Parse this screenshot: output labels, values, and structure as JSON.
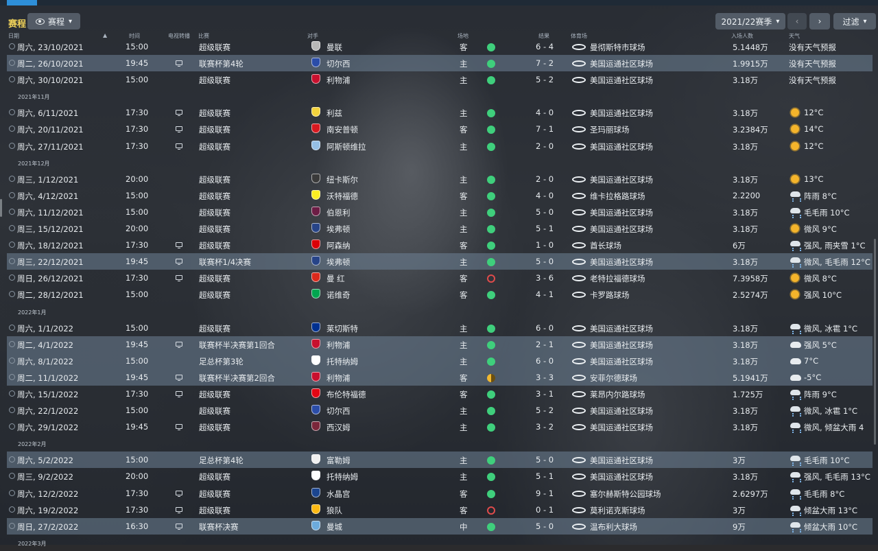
{
  "header": {
    "title": "赛程",
    "view_button": "赛程",
    "season_button": "2021/22赛季",
    "filter_button": "过滤"
  },
  "columns": {
    "date": "日期",
    "time": "时间",
    "tv": "电视转播",
    "competition": "比赛",
    "opponent": "对手",
    "venue": "场地",
    "result": "结果",
    "stadium": "体育场",
    "attendance": "入场人数",
    "weather": "天气"
  },
  "rows": [
    {
      "type": "match",
      "date": "周六, 23/10/2021",
      "time": "15:00",
      "tv": false,
      "comp": "超级联赛",
      "opp": "曼联",
      "venue": "客",
      "res": "win",
      "score": "6 - 4",
      "stadium": "曼彻斯特市球场",
      "att": "5.1448万",
      "wx": "none",
      "weather": "没有天气预报",
      "crest": "#b8b8b8",
      "hl": false
    },
    {
      "type": "match",
      "date": "周二, 26/10/2021",
      "time": "19:45",
      "tv": true,
      "comp": "联赛杯第4轮",
      "opp": "切尔西",
      "venue": "主",
      "res": "win",
      "score": "7 - 2",
      "stadium": "美国运通社区球场",
      "att": "1.9915万",
      "wx": "none",
      "weather": "没有天气预报",
      "crest": "#2b4da8",
      "hl": true
    },
    {
      "type": "match",
      "date": "周六, 30/10/2021",
      "time": "15:00",
      "tv": false,
      "comp": "超级联赛",
      "opp": "利物浦",
      "venue": "主",
      "res": "win",
      "score": "5 - 2",
      "stadium": "美国运通社区球场",
      "att": "3.18万",
      "wx": "none",
      "weather": "没有天气预报",
      "crest": "#c8102e",
      "hl": false
    },
    {
      "type": "month",
      "label": "2021年11月"
    },
    {
      "type": "match",
      "date": "周六, 6/11/2021",
      "time": "17:30",
      "tv": true,
      "comp": "超级联赛",
      "opp": "利兹",
      "venue": "主",
      "res": "win",
      "score": "4 - 0",
      "stadium": "美国运通社区球场",
      "att": "3.18万",
      "wx": "sun",
      "weather": "12°C",
      "crest": "#f2d23c",
      "hl": false
    },
    {
      "type": "match",
      "date": "周六, 20/11/2021",
      "time": "17:30",
      "tv": true,
      "comp": "超级联赛",
      "opp": "南安普顿",
      "venue": "客",
      "res": "win",
      "score": "7 - 1",
      "stadium": "圣玛丽球场",
      "att": "3.2384万",
      "wx": "sun",
      "weather": "14°C",
      "crest": "#d71920",
      "hl": false
    },
    {
      "type": "match",
      "date": "周六, 27/11/2021",
      "time": "17:30",
      "tv": true,
      "comp": "超级联赛",
      "opp": "阿斯顿维拉",
      "venue": "主",
      "res": "win",
      "score": "2 - 0",
      "stadium": "美国运通社区球场",
      "att": "3.18万",
      "wx": "sun",
      "weather": "12°C",
      "crest": "#95bfe5",
      "hl": false
    },
    {
      "type": "month",
      "label": "2021年12月"
    },
    {
      "type": "match",
      "date": "周三, 1/12/2021",
      "time": "20:00",
      "tv": false,
      "comp": "超级联赛",
      "opp": "纽卡斯尔",
      "venue": "主",
      "res": "win",
      "score": "2 - 0",
      "stadium": "美国运通社区球场",
      "att": "3.18万",
      "wx": "sun",
      "weather": "13°C",
      "crest": "#3a3a3a",
      "hl": false
    },
    {
      "type": "match",
      "date": "周六, 4/12/2021",
      "time": "15:00",
      "tv": false,
      "comp": "超级联赛",
      "opp": "沃特福德",
      "venue": "客",
      "res": "win",
      "score": "4 - 0",
      "stadium": "维卡拉格路球场",
      "att": "2.2200",
      "wx": "rain",
      "weather": "阵雨 8°C",
      "crest": "#fbee23",
      "hl": false
    },
    {
      "type": "match",
      "date": "周六, 11/12/2021",
      "time": "15:00",
      "tv": false,
      "comp": "超级联赛",
      "opp": "伯恩利",
      "venue": "主",
      "res": "win",
      "score": "5 - 0",
      "stadium": "美国运通社区球场",
      "att": "3.18万",
      "wx": "rain",
      "weather": "毛毛雨 10°C",
      "crest": "#6c1d45",
      "hl": false
    },
    {
      "type": "match",
      "date": "周三, 15/12/2021",
      "time": "20:00",
      "tv": false,
      "comp": "超级联赛",
      "opp": "埃弗顿",
      "venue": "主",
      "res": "win",
      "score": "5 - 1",
      "stadium": "美国运通社区球场",
      "att": "3.18万",
      "wx": "sun",
      "weather": "微风 9°C",
      "crest": "#274488",
      "hl": false
    },
    {
      "type": "match",
      "date": "周六, 18/12/2021",
      "time": "17:30",
      "tv": true,
      "comp": "超级联赛",
      "opp": "阿森纳",
      "venue": "客",
      "res": "win",
      "score": "1 - 0",
      "stadium": "酋长球场",
      "att": "6万",
      "wx": "rain",
      "weather": "强风, 雨夹雪 1°C",
      "crest": "#db0007",
      "hl": false
    },
    {
      "type": "match",
      "date": "周三, 22/12/2021",
      "time": "19:45",
      "tv": true,
      "comp": "联赛杯1/4决赛",
      "opp": "埃弗顿",
      "venue": "主",
      "res": "win",
      "score": "5 - 0",
      "stadium": "美国运通社区球场",
      "att": "3.18万",
      "wx": "rain",
      "weather": "微风, 毛毛雨 12°C",
      "crest": "#274488",
      "hl": true
    },
    {
      "type": "match",
      "date": "周日, 26/12/2021",
      "time": "17:30",
      "tv": true,
      "comp": "超级联赛",
      "opp": "曼 红",
      "venue": "客",
      "res": "loss",
      "score": "3 - 6",
      "stadium": "老特拉福德球场",
      "att": "7.3958万",
      "wx": "sun",
      "weather": "微风 8°C",
      "crest": "#da291c",
      "hl": false
    },
    {
      "type": "match",
      "date": "周二, 28/12/2021",
      "time": "15:00",
      "tv": false,
      "comp": "超级联赛",
      "opp": "诺维奇",
      "venue": "客",
      "res": "win",
      "score": "4 - 1",
      "stadium": "卡罗路球场",
      "att": "2.5274万",
      "wx": "sun",
      "weather": "强风 10°C",
      "crest": "#00a650",
      "hl": false
    },
    {
      "type": "month",
      "label": "2022年1月"
    },
    {
      "type": "match",
      "date": "周六, 1/1/2022",
      "time": "15:00",
      "tv": false,
      "comp": "超级联赛",
      "opp": "莱切斯特",
      "venue": "主",
      "res": "win",
      "score": "6 - 0",
      "stadium": "美国运通社区球场",
      "att": "3.18万",
      "wx": "rain",
      "weather": "微风, 冰雹 1°C",
      "crest": "#003090",
      "hl": false
    },
    {
      "type": "match",
      "date": "周二, 4/1/2022",
      "time": "19:45",
      "tv": true,
      "comp": "联赛杯半决赛第1回合",
      "opp": "利物浦",
      "venue": "主",
      "res": "win",
      "score": "2 - 1",
      "stadium": "美国运通社区球场",
      "att": "3.18万",
      "wx": "cloud",
      "weather": "强风 5°C",
      "crest": "#c8102e",
      "hl": true
    },
    {
      "type": "match",
      "date": "周六, 8/1/2022",
      "time": "15:00",
      "tv": false,
      "comp": "足总杯第3轮",
      "opp": "托特纳姆",
      "venue": "主",
      "res": "win",
      "score": "6 - 0",
      "stadium": "美国运通社区球场",
      "att": "3.18万",
      "wx": "cloud",
      "weather": "7°C",
      "crest": "#ffffff",
      "hl": true
    },
    {
      "type": "match",
      "date": "周二, 11/1/2022",
      "time": "19:45",
      "tv": true,
      "comp": "联赛杯半决赛第2回合",
      "opp": "利物浦",
      "venue": "客",
      "res": "draw",
      "score": "3 - 3",
      "stadium": "安菲尔德球场",
      "att": "5.1941万",
      "wx": "cloud",
      "weather": "-5°C",
      "crest": "#c8102e",
      "hl": true
    },
    {
      "type": "match",
      "date": "周六, 15/1/2022",
      "time": "17:30",
      "tv": true,
      "comp": "超级联赛",
      "opp": "布伦特福德",
      "venue": "客",
      "res": "win",
      "score": "3 - 1",
      "stadium": "莱昂内尔路球场",
      "att": "1.725万",
      "wx": "rain",
      "weather": "阵雨 9°C",
      "crest": "#e30613",
      "hl": false
    },
    {
      "type": "match",
      "date": "周六, 22/1/2022",
      "time": "15:00",
      "tv": false,
      "comp": "超级联赛",
      "opp": "切尔西",
      "venue": "主",
      "res": "win",
      "score": "5 - 2",
      "stadium": "美国运通社区球场",
      "att": "3.18万",
      "wx": "rain",
      "weather": "微风, 冰雹 1°C",
      "crest": "#2b4da8",
      "hl": false
    },
    {
      "type": "match",
      "date": "周六, 29/1/2022",
      "time": "19:45",
      "tv": true,
      "comp": "超级联赛",
      "opp": "西汉姆",
      "venue": "主",
      "res": "win",
      "score": "3 - 2",
      "stadium": "美国运通社区球场",
      "att": "3.18万",
      "wx": "rain",
      "weather": "微风, 倾盆大雨 4",
      "crest": "#7a263a",
      "hl": false
    },
    {
      "type": "month",
      "label": "2022年2月"
    },
    {
      "type": "match",
      "date": "周六, 5/2/2022",
      "time": "15:00",
      "tv": false,
      "comp": "足总杯第4轮",
      "opp": "富勒姆",
      "venue": "主",
      "res": "win",
      "score": "5 - 0",
      "stadium": "美国运通社区球场",
      "att": "3万",
      "wx": "rain",
      "weather": "毛毛雨 10°C",
      "crest": "#f0f0f0",
      "hl": true
    },
    {
      "type": "match",
      "date": "周三, 9/2/2022",
      "time": "20:00",
      "tv": false,
      "comp": "超级联赛",
      "opp": "托特纳姆",
      "venue": "主",
      "res": "win",
      "score": "5 - 1",
      "stadium": "美国运通社区球场",
      "att": "3.18万",
      "wx": "rain",
      "weather": "强风, 毛毛雨 13°C",
      "crest": "#ffffff",
      "hl": false
    },
    {
      "type": "match",
      "date": "周六, 12/2/2022",
      "time": "17:30",
      "tv": true,
      "comp": "超级联赛",
      "opp": "水晶宫",
      "venue": "客",
      "res": "win",
      "score": "9 - 1",
      "stadium": "塞尔赫斯特公园球场",
      "att": "2.6297万",
      "wx": "rain",
      "weather": "毛毛雨 8°C",
      "crest": "#1b458f",
      "hl": false
    },
    {
      "type": "match",
      "date": "周六, 19/2/2022",
      "time": "17:30",
      "tv": true,
      "comp": "超级联赛",
      "opp": "狼队",
      "venue": "客",
      "res": "loss",
      "score": "0 - 1",
      "stadium": "莫利诺克斯球场",
      "att": "3万",
      "wx": "rain",
      "weather": "倾盆大雨 13°C",
      "crest": "#fdb913",
      "hl": false
    },
    {
      "type": "match",
      "date": "周日, 27/2/2022",
      "time": "16:30",
      "tv": true,
      "comp": "联赛杯决赛",
      "opp": "曼城",
      "venue": "中",
      "res": "win",
      "score": "5 - 0",
      "stadium": "温布利大球场",
      "att": "9万",
      "wx": "rain",
      "weather": "倾盆大雨 10°C",
      "crest": "#6cabdd",
      "hl": true
    },
    {
      "type": "month",
      "label": "2022年3月"
    }
  ]
}
